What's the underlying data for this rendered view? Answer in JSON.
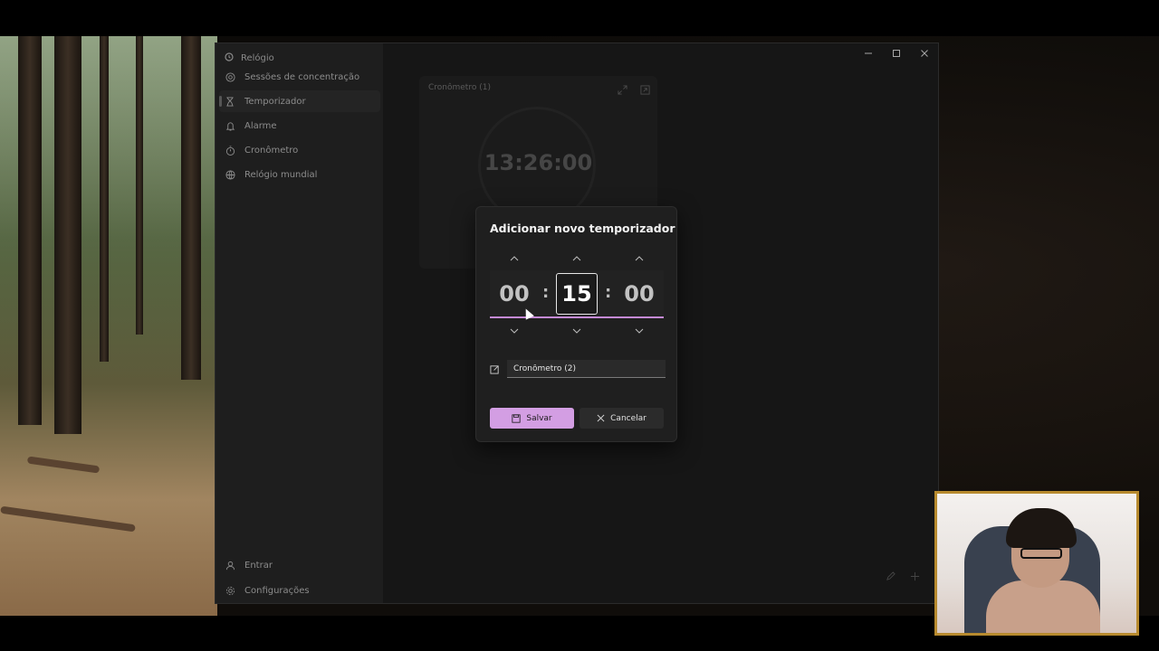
{
  "app": {
    "title": "Relógio"
  },
  "sidebar": {
    "items": [
      {
        "label": "Sessões de concentração",
        "icon": "focus-icon"
      },
      {
        "label": "Temporizador",
        "icon": "hourglass-icon",
        "active": true
      },
      {
        "label": "Alarme",
        "icon": "bell-icon"
      },
      {
        "label": "Cronômetro",
        "icon": "stopwatch-icon"
      },
      {
        "label": "Relógio mundial",
        "icon": "globe-icon"
      }
    ],
    "footer": [
      {
        "label": "Entrar",
        "icon": "user-icon"
      },
      {
        "label": "Configurações",
        "icon": "gear-icon"
      }
    ]
  },
  "timer_card": {
    "title": "Cronômetro (1)",
    "time": "13:26:00"
  },
  "dialog": {
    "title": "Adicionar novo temporizador",
    "hours": "00",
    "minutes": "15",
    "seconds": "00",
    "separator": ":",
    "name_value": "Cronômetro (2)",
    "save_label": "Salvar",
    "cancel_label": "Cancelar"
  },
  "colors": {
    "accent": "#d39ee3",
    "accent_line": "#c58ad6"
  }
}
